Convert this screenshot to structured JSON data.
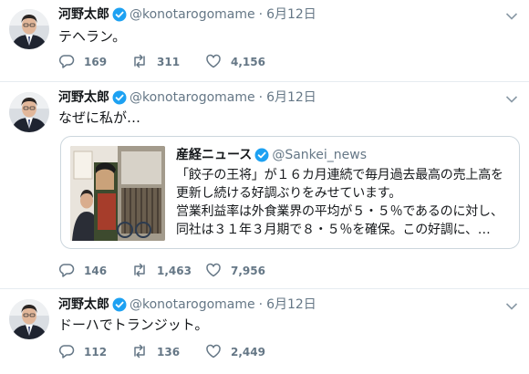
{
  "tweets": [
    {
      "author": "河野太郎",
      "handle": "@konotarogomame",
      "separator": "·",
      "date": "6月12日",
      "text": "テヘラン。",
      "replies": "169",
      "retweets": "311",
      "likes": "4,156"
    },
    {
      "author": "河野太郎",
      "handle": "@konotarogomame",
      "separator": "·",
      "date": "6月12日",
      "text": "なぜに私が…",
      "quote": {
        "author": "産経ニュース",
        "handle": "@Sankei_news",
        "lines": [
          "「餃子の王将」が１６カ月連続で毎月過去最高の売上高を",
          "更新し続ける好調ぶりをみせています。",
          "営業利益率は外食業界の平均が５・５％であるのに対し、",
          "同社は３１年３月期で８・５％を確保。この好調に、…"
        ]
      },
      "replies": "146",
      "retweets": "1,463",
      "likes": "7,956"
    },
    {
      "author": "河野太郎",
      "handle": "@konotarogomame",
      "separator": "·",
      "date": "6月12日",
      "text": "ドーハでトランジット。",
      "replies": "112",
      "retweets": "136",
      "likes": "2,449"
    }
  ],
  "colors": {
    "verified": "#1da1f2",
    "muted": "#657786",
    "border": "#e6ecf0"
  },
  "icons": [
    "verified-badge-icon",
    "chevron-down-icon",
    "reply-icon",
    "retweet-icon",
    "like-icon"
  ]
}
